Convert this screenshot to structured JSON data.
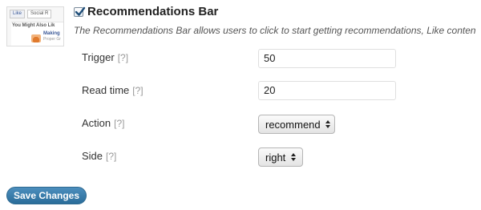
{
  "section": {
    "enabled": true,
    "title": "Recommendations Bar",
    "description": "The Recommendations Bar allows users to click to start getting recommendations, Like conten"
  },
  "thumbnail": {
    "like_label": "Like",
    "social_label": "Social R",
    "you_might_label": "You Might Also Lik",
    "making_label": "Making",
    "making_sub": "Proper Gr"
  },
  "fields": {
    "help": "[?]",
    "trigger": {
      "label": "Trigger",
      "value": "50"
    },
    "read_time": {
      "label": "Read time",
      "value": "20"
    },
    "action": {
      "label": "Action",
      "selected": "recommend"
    },
    "side": {
      "label": "Side",
      "selected": "right"
    }
  },
  "save_label": "Save Changes",
  "colors": {
    "button": "#2a6d9a",
    "checkmark": "#1f4e79"
  }
}
